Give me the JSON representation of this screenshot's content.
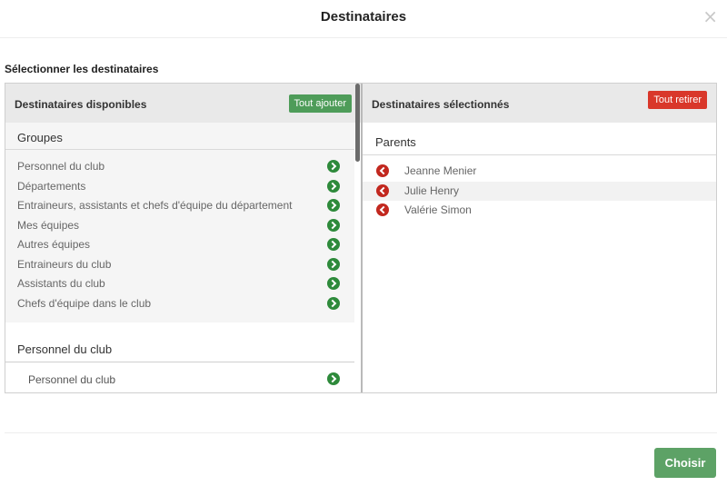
{
  "modal": {
    "title": "Destinataires",
    "close_symbol": "×"
  },
  "section_label": "Sélectionner les destinataires",
  "available": {
    "title": "Destinataires disponibles",
    "add_all_label": "Tout ajouter",
    "groups": {
      "header": "Groupes",
      "items": [
        {
          "label": "Personnel du club"
        },
        {
          "label": "Départements"
        },
        {
          "label": "Entraineurs, assistants et chefs d'équipe du département"
        },
        {
          "label": "Mes équipes"
        },
        {
          "label": "Autres équipes"
        },
        {
          "label": "Entraineurs du club"
        },
        {
          "label": "Assistants du club"
        },
        {
          "label": "Chefs d'équipe dans le club"
        }
      ]
    },
    "club": {
      "header": "Personnel du club",
      "items": [
        {
          "label": "Personnel du club"
        }
      ]
    }
  },
  "selected": {
    "title": "Destinataires sélectionnés",
    "remove_all_label": "Tout retirer",
    "parents": {
      "header": "Parents",
      "items": [
        {
          "label": "Jeanne Menier"
        },
        {
          "label": "Julie Henry"
        },
        {
          "label": "Valérie Simon"
        }
      ]
    }
  },
  "footer": {
    "choose_label": "Choisir"
  },
  "colors": {
    "green": "#4e9c59",
    "red": "#d9372a",
    "choose_green": "#5da266"
  }
}
